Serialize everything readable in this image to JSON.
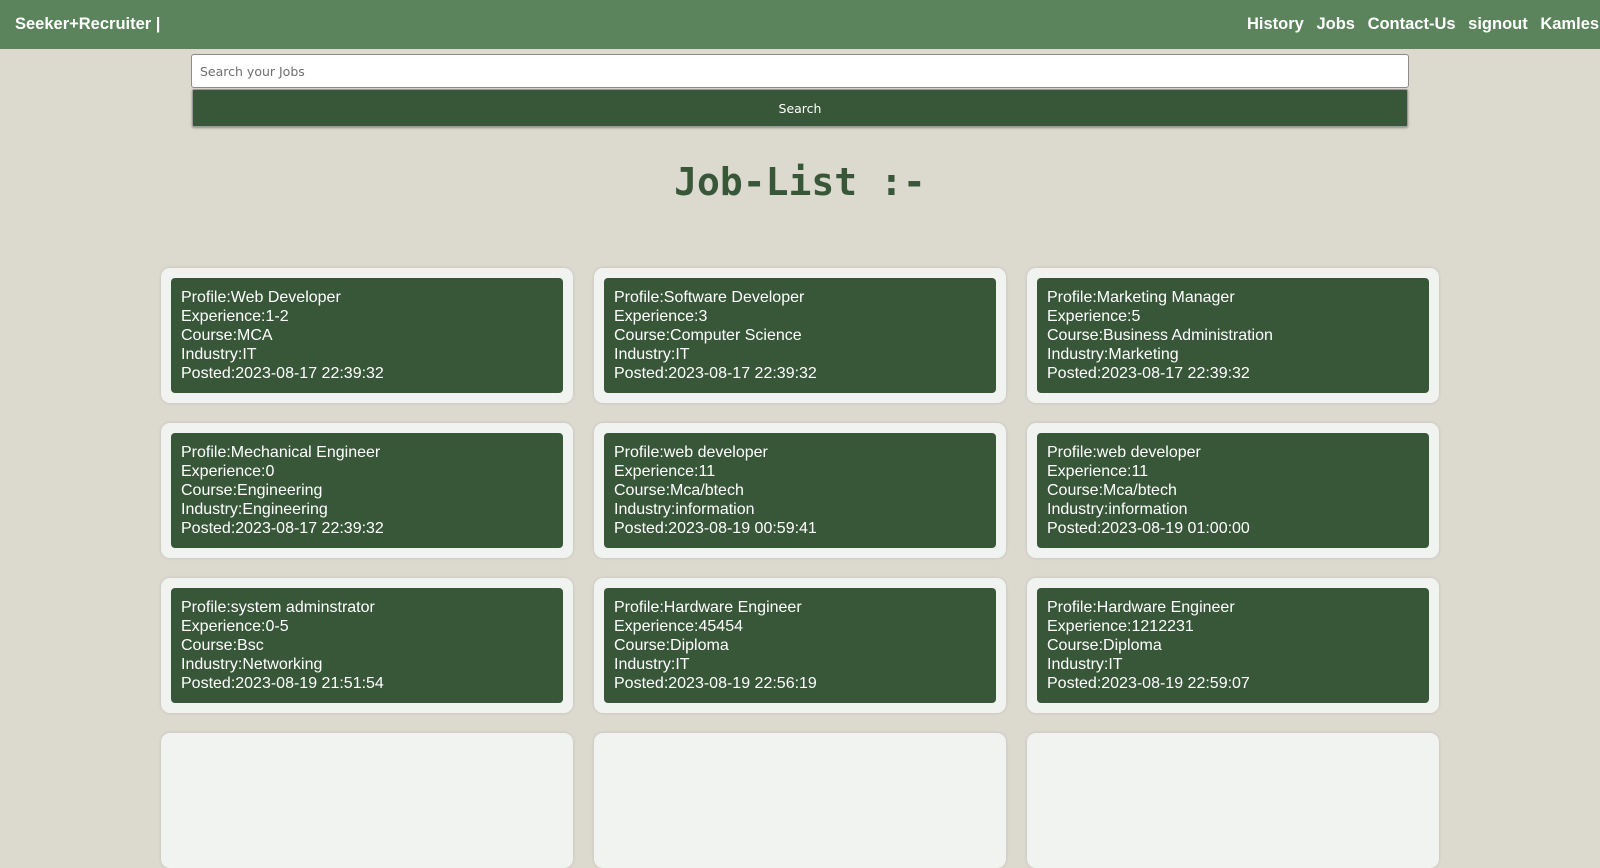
{
  "navbar": {
    "brand": "Seeker+Recruiter |",
    "links": [
      "History",
      "Jobs",
      "Contact-Us",
      "signout",
      "Kamlesh S"
    ]
  },
  "search": {
    "placeholder": "Search your Jobs",
    "value": "",
    "button_label": "Search"
  },
  "page_title": "Job-List :-",
  "jobs": [
    {
      "profile": "Profile:Web Developer",
      "experience": "Experience:1-2",
      "course": "Course:MCA",
      "industry": "Industry:IT",
      "posted": "Posted:2023-08-17 22:39:32"
    },
    {
      "profile": "Profile:Software Developer",
      "experience": "Experience:3",
      "course": "Course:Computer Science",
      "industry": "Industry:IT",
      "posted": "Posted:2023-08-17 22:39:32"
    },
    {
      "profile": "Profile:Marketing Manager",
      "experience": "Experience:5",
      "course": "Course:Business Administration",
      "industry": "Industry:Marketing",
      "posted": "Posted:2023-08-17 22:39:32"
    },
    {
      "profile": "Profile:Mechanical Engineer",
      "experience": "Experience:0",
      "course": "Course:Engineering",
      "industry": "Industry:Engineering",
      "posted": "Posted:2023-08-17 22:39:32"
    },
    {
      "profile": "Profile:web developer",
      "experience": "Experience:11",
      "course": "Course:Mca/btech",
      "industry": "Industry:information",
      "posted": "Posted:2023-08-19 00:59:41"
    },
    {
      "profile": "Profile:web developer",
      "experience": "Experience:11",
      "course": "Course:Mca/btech",
      "industry": "Industry:information",
      "posted": "Posted:2023-08-19 01:00:00"
    },
    {
      "profile": "Profile:system adminstrator",
      "experience": "Experience:0-5",
      "course": "Course:Bsc",
      "industry": "Industry:Networking",
      "posted": "Posted:2023-08-19 21:51:54"
    },
    {
      "profile": "Profile:Hardware Engineer",
      "experience": "Experience:45454",
      "course": "Course:Diploma",
      "industry": "Industry:IT",
      "posted": "Posted:2023-08-19 22:56:19"
    },
    {
      "profile": "Profile:Hardware Engineer",
      "experience": "Experience:1212231",
      "course": "Course:Diploma",
      "industry": "Industry:IT",
      "posted": "Posted:2023-08-19 22:59:07"
    }
  ],
  "colors": {
    "navbar_bg": "#5b845c",
    "page_bg": "#dcd9cf",
    "accent_dark_green": "#385739",
    "card_outer_bg": "#f1f3f0"
  }
}
